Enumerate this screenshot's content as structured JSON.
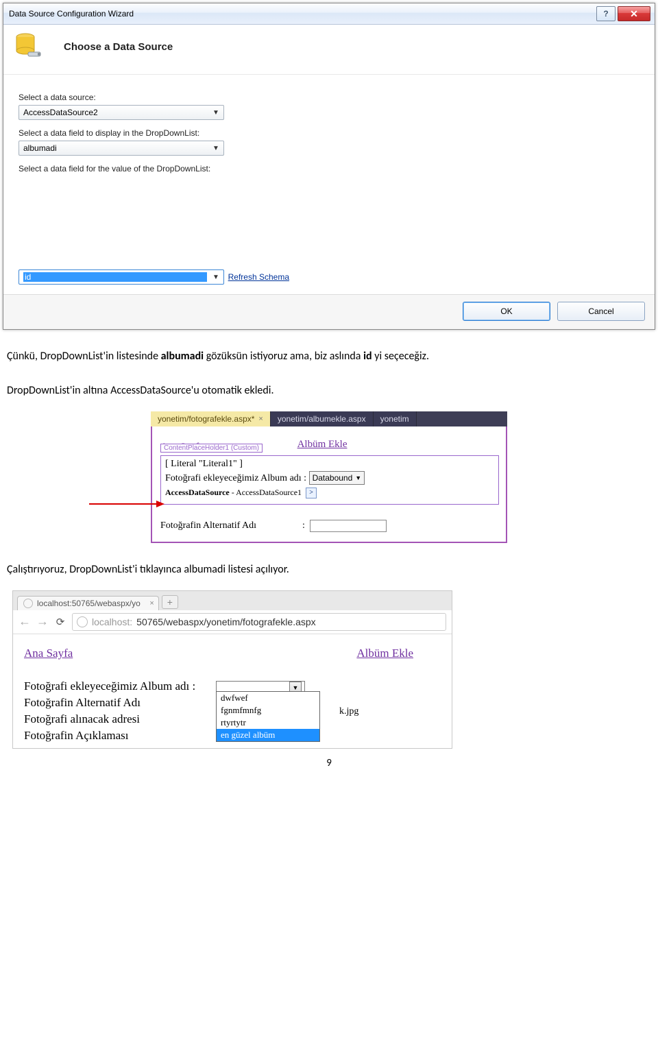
{
  "dialog": {
    "title": "Data Source Configuration Wizard",
    "header": "Choose a Data Source",
    "labels": {
      "select_source": "Select a data source:",
      "select_display": "Select a data field to display in the DropDownList:",
      "select_value": "Select a data field for the value of the DropDownList:"
    },
    "fields": {
      "source": "AccessDataSource2",
      "display_field": "albumadi",
      "value_field": "id"
    },
    "refresh_link": "Refresh Schema",
    "buttons": {
      "ok": "OK",
      "cancel": "Cancel"
    },
    "help_glyph": "?",
    "close_glyph": "✕"
  },
  "paragraphs": {
    "p1_pre": "Çünkü, DropDownList'in listesinde ",
    "p1_b1": "albumadi",
    "p1_mid": " gözüksün istiyoruz ama, biz aslında ",
    "p1_b2": "id",
    "p1_post": " yi seçeceğiz.",
    "p2": "DropDownList'in altına AccessDataSource'u otomatik ekledi.",
    "p3": "Çalıştırıyoruz, DropDownList'i tıklayınca albumadi listesi açılıyor."
  },
  "shot2": {
    "tabs": {
      "active": "yonetim/fotografekle.aspx*",
      "t2": "yonetim/albumekle.aspx",
      "t3": "yonetim"
    },
    "nav_left_partial": "Ana Sayfa",
    "cph_label": "ContentPlaceHolder1 (Custom)",
    "album_ekle": "Albüm Ekle",
    "literal": "[ Literal \"Literal1\" ]",
    "row_label": "Fotoğrafi ekleyeceğimiz Album adı :",
    "dd_value": "Databound",
    "ads_bold": "AccessDataSource",
    "ads_rest": " - AccessDataSource1",
    "smart_glyph": ">",
    "alt_label": "Fotoğrafin Alternatif Adı",
    "alt_colon": ":"
  },
  "shot3": {
    "tab_title": "localhost:50765/webaspx/yo",
    "url_host": "localhost:",
    "url_path": "50765/webaspx/yonetim/fotografekle.aspx",
    "links": {
      "home": "Ana Sayfa",
      "album": "Albüm Ekle"
    },
    "rows": {
      "r1": "Fotoğrafi ekleyeceğimiz Album adı :",
      "r2": "Fotoğrafin Alternatif Adı",
      "r3": "Fotoğrafi alınacak adresi",
      "r4": "Fotoğrafin Açıklaması"
    },
    "colon": ":",
    "dropdown_items": [
      "dwfwef",
      "fgnmfmnfg",
      "rtyrtytr",
      "en güzel albüm"
    ],
    "dropdown_selected_index": 3,
    "jpg_fragment": "k.jpg",
    "new_tab_glyph": "+",
    "close_glyph": "×"
  },
  "page_number": "9"
}
